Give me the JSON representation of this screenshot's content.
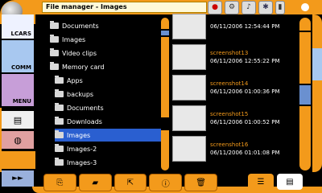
{
  "window_title": "File manager - Images",
  "sidebar": {
    "lcars_label": "LCARS",
    "comm_label": "COMM",
    "menu_label": "MENU",
    "arrow_label": "►►"
  },
  "top_icons": [
    "power-icon",
    "settings-icon",
    "media-icon",
    "bluetooth-icon",
    "battery-icon"
  ],
  "tree": [
    {
      "label": "Documents",
      "indent": 0
    },
    {
      "label": "Images",
      "indent": 0
    },
    {
      "label": "Video clips",
      "indent": 0
    },
    {
      "label": "Memory card",
      "indent": 0
    },
    {
      "label": "Apps",
      "indent": 1
    },
    {
      "label": "backups",
      "indent": 1
    },
    {
      "label": "Documents",
      "indent": 1
    },
    {
      "label": "Downloads",
      "indent": 1
    },
    {
      "label": "Images",
      "indent": 1,
      "selected": true
    },
    {
      "label": "Images-2",
      "indent": 1
    },
    {
      "label": "Images-3",
      "indent": 1
    }
  ],
  "files": [
    {
      "name": "",
      "date": "06/11/2006 12:54:44 PM"
    },
    {
      "name": "screenshot13",
      "date": "06/11/2006 12:55:22 PM"
    },
    {
      "name": "screenshot14",
      "date": "06/11/2006 01:00:36 PM"
    },
    {
      "name": "screenshot15",
      "date": "06/11/2006 01:00:52 PM"
    },
    {
      "name": "screenshot16",
      "date": "06/11/2006 01:01:08 PM"
    }
  ],
  "toolbar": [
    "copy-icon",
    "open-icon",
    "export-icon",
    "info-icon",
    "delete-icon"
  ],
  "colors": {
    "accent": "#f39a1b",
    "selection": "#2a5fd0",
    "scroll_thumb": "#6a90d0"
  }
}
